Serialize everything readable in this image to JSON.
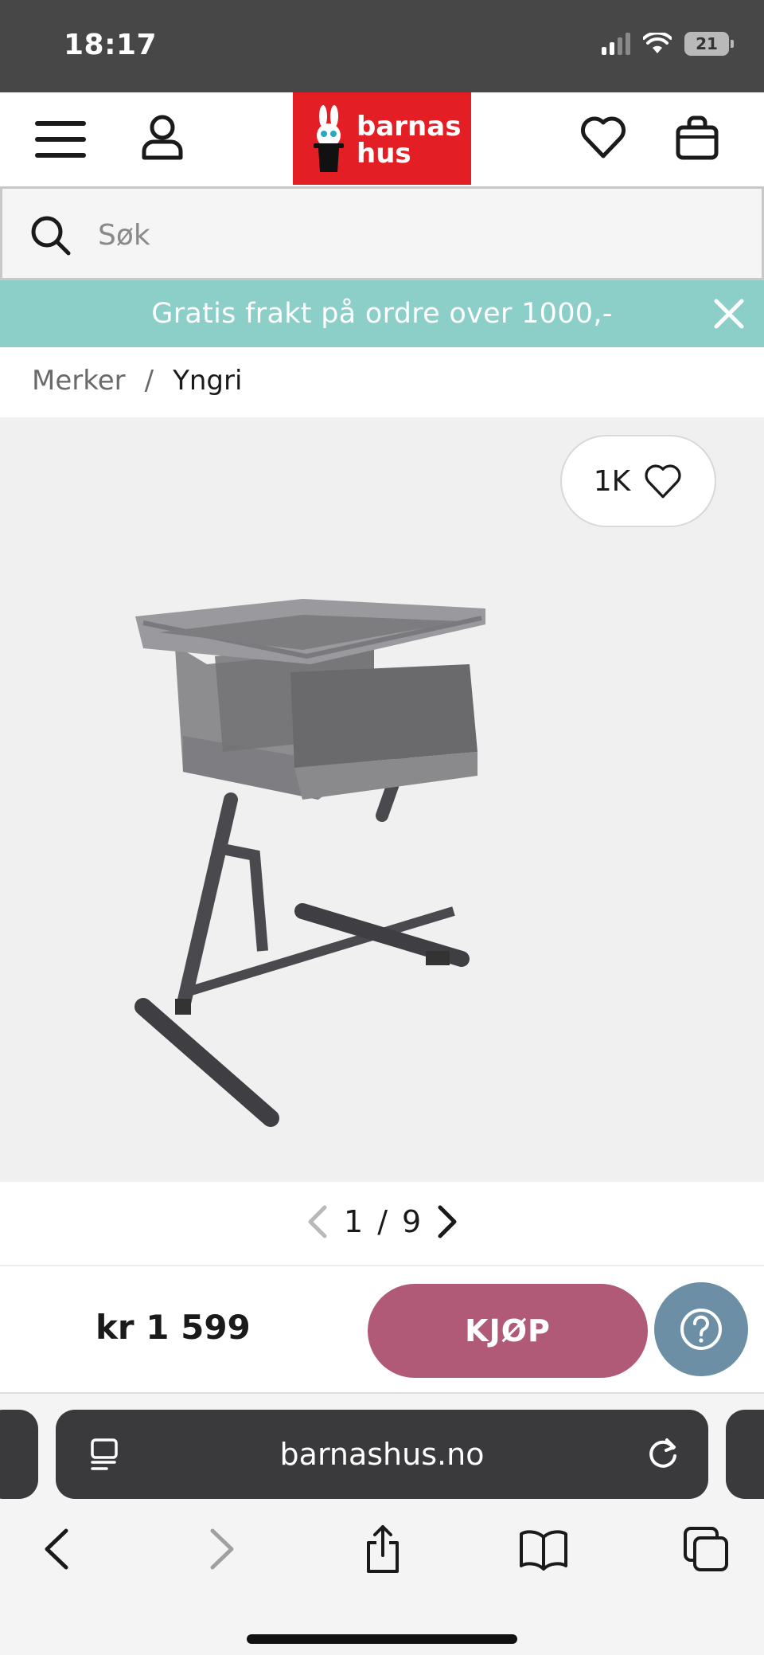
{
  "status_bar": {
    "time": "18:17",
    "battery": "21"
  },
  "header": {
    "logo_text_line1": "barnas",
    "logo_text_line2": "hus",
    "brand_color": "#e31e24"
  },
  "search": {
    "placeholder": "Søk"
  },
  "promo": {
    "text": "Gratis frakt på ordre over 1000,-",
    "bg_color": "#8ccfc8"
  },
  "breadcrumb": {
    "items": [
      "Merker",
      "Yngri"
    ],
    "separator": "/"
  },
  "gallery": {
    "favorites_count": "1K",
    "current": "1",
    "separator": "/",
    "total": "9"
  },
  "purchase": {
    "price": "kr 1 599",
    "buy_label": "KJØP",
    "buy_color": "#b05a78",
    "help_color": "#6c8fa6"
  },
  "browser": {
    "url": "barnashus.no"
  }
}
